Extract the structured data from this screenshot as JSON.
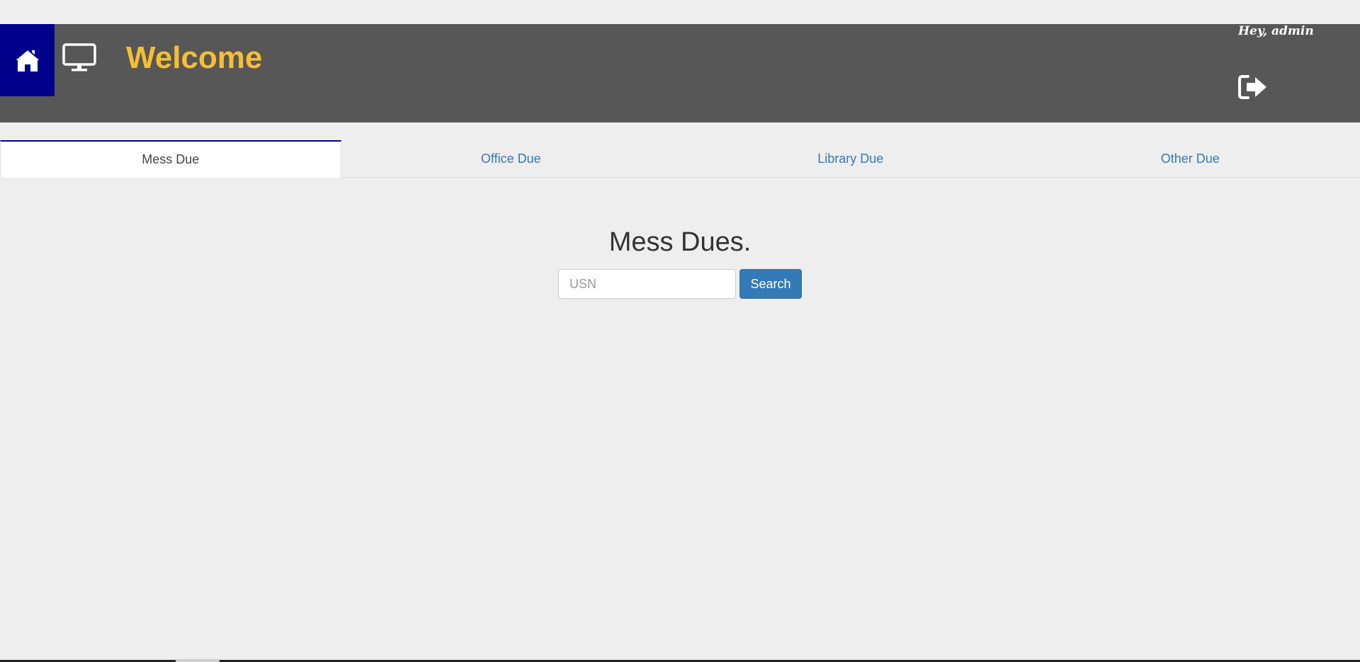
{
  "header": {
    "title": "Welcome",
    "greeting": "Hey, admin",
    "home_icon": "home-icon",
    "monitor_icon": "monitor-icon",
    "logout_icon": "logout-icon",
    "title_color": "#f6be34",
    "home_bg": "#00008b",
    "bar_bg": "#575757"
  },
  "tabs": [
    {
      "label": "Mess Due",
      "active": true
    },
    {
      "label": "Office Due",
      "active": false
    },
    {
      "label": "Library Due",
      "active": false
    },
    {
      "label": "Other Due",
      "active": false
    }
  ],
  "main": {
    "heading": "Mess Dues.",
    "search": {
      "placeholder": "USN",
      "value": "",
      "button_label": "Search"
    }
  }
}
